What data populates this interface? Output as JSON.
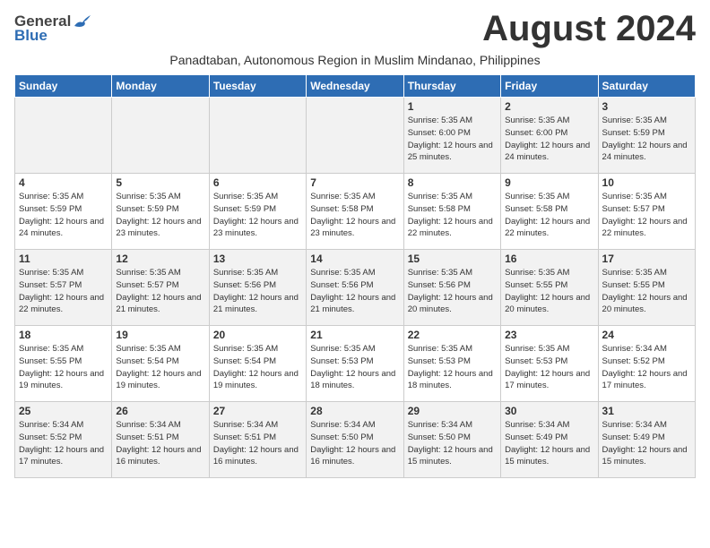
{
  "header": {
    "logo_general": "General",
    "logo_blue": "Blue",
    "month_title": "August 2024",
    "subtitle": "Panadtaban, Autonomous Region in Muslim Mindanao, Philippines"
  },
  "days_of_week": [
    "Sunday",
    "Monday",
    "Tuesday",
    "Wednesday",
    "Thursday",
    "Friday",
    "Saturday"
  ],
  "weeks": [
    {
      "days": [
        {
          "number": "",
          "info": ""
        },
        {
          "number": "",
          "info": ""
        },
        {
          "number": "",
          "info": ""
        },
        {
          "number": "",
          "info": ""
        },
        {
          "number": "1",
          "info": "Sunrise: 5:35 AM\nSunset: 6:00 PM\nDaylight: 12 hours\nand 25 minutes."
        },
        {
          "number": "2",
          "info": "Sunrise: 5:35 AM\nSunset: 6:00 PM\nDaylight: 12 hours\nand 24 minutes."
        },
        {
          "number": "3",
          "info": "Sunrise: 5:35 AM\nSunset: 5:59 PM\nDaylight: 12 hours\nand 24 minutes."
        }
      ]
    },
    {
      "days": [
        {
          "number": "4",
          "info": "Sunrise: 5:35 AM\nSunset: 5:59 PM\nDaylight: 12 hours\nand 24 minutes."
        },
        {
          "number": "5",
          "info": "Sunrise: 5:35 AM\nSunset: 5:59 PM\nDaylight: 12 hours\nand 23 minutes."
        },
        {
          "number": "6",
          "info": "Sunrise: 5:35 AM\nSunset: 5:59 PM\nDaylight: 12 hours\nand 23 minutes."
        },
        {
          "number": "7",
          "info": "Sunrise: 5:35 AM\nSunset: 5:58 PM\nDaylight: 12 hours\nand 23 minutes."
        },
        {
          "number": "8",
          "info": "Sunrise: 5:35 AM\nSunset: 5:58 PM\nDaylight: 12 hours\nand 22 minutes."
        },
        {
          "number": "9",
          "info": "Sunrise: 5:35 AM\nSunset: 5:58 PM\nDaylight: 12 hours\nand 22 minutes."
        },
        {
          "number": "10",
          "info": "Sunrise: 5:35 AM\nSunset: 5:57 PM\nDaylight: 12 hours\nand 22 minutes."
        }
      ]
    },
    {
      "days": [
        {
          "number": "11",
          "info": "Sunrise: 5:35 AM\nSunset: 5:57 PM\nDaylight: 12 hours\nand 22 minutes."
        },
        {
          "number": "12",
          "info": "Sunrise: 5:35 AM\nSunset: 5:57 PM\nDaylight: 12 hours\nand 21 minutes."
        },
        {
          "number": "13",
          "info": "Sunrise: 5:35 AM\nSunset: 5:56 PM\nDaylight: 12 hours\nand 21 minutes."
        },
        {
          "number": "14",
          "info": "Sunrise: 5:35 AM\nSunset: 5:56 PM\nDaylight: 12 hours\nand 21 minutes."
        },
        {
          "number": "15",
          "info": "Sunrise: 5:35 AM\nSunset: 5:56 PM\nDaylight: 12 hours\nand 20 minutes."
        },
        {
          "number": "16",
          "info": "Sunrise: 5:35 AM\nSunset: 5:55 PM\nDaylight: 12 hours\nand 20 minutes."
        },
        {
          "number": "17",
          "info": "Sunrise: 5:35 AM\nSunset: 5:55 PM\nDaylight: 12 hours\nand 20 minutes."
        }
      ]
    },
    {
      "days": [
        {
          "number": "18",
          "info": "Sunrise: 5:35 AM\nSunset: 5:55 PM\nDaylight: 12 hours\nand 19 minutes."
        },
        {
          "number": "19",
          "info": "Sunrise: 5:35 AM\nSunset: 5:54 PM\nDaylight: 12 hours\nand 19 minutes."
        },
        {
          "number": "20",
          "info": "Sunrise: 5:35 AM\nSunset: 5:54 PM\nDaylight: 12 hours\nand 19 minutes."
        },
        {
          "number": "21",
          "info": "Sunrise: 5:35 AM\nSunset: 5:53 PM\nDaylight: 12 hours\nand 18 minutes."
        },
        {
          "number": "22",
          "info": "Sunrise: 5:35 AM\nSunset: 5:53 PM\nDaylight: 12 hours\nand 18 minutes."
        },
        {
          "number": "23",
          "info": "Sunrise: 5:35 AM\nSunset: 5:53 PM\nDaylight: 12 hours\nand 17 minutes."
        },
        {
          "number": "24",
          "info": "Sunrise: 5:34 AM\nSunset: 5:52 PM\nDaylight: 12 hours\nand 17 minutes."
        }
      ]
    },
    {
      "days": [
        {
          "number": "25",
          "info": "Sunrise: 5:34 AM\nSunset: 5:52 PM\nDaylight: 12 hours\nand 17 minutes."
        },
        {
          "number": "26",
          "info": "Sunrise: 5:34 AM\nSunset: 5:51 PM\nDaylight: 12 hours\nand 16 minutes."
        },
        {
          "number": "27",
          "info": "Sunrise: 5:34 AM\nSunset: 5:51 PM\nDaylight: 12 hours\nand 16 minutes."
        },
        {
          "number": "28",
          "info": "Sunrise: 5:34 AM\nSunset: 5:50 PM\nDaylight: 12 hours\nand 16 minutes."
        },
        {
          "number": "29",
          "info": "Sunrise: 5:34 AM\nSunset: 5:50 PM\nDaylight: 12 hours\nand 15 minutes."
        },
        {
          "number": "30",
          "info": "Sunrise: 5:34 AM\nSunset: 5:49 PM\nDaylight: 12 hours\nand 15 minutes."
        },
        {
          "number": "31",
          "info": "Sunrise: 5:34 AM\nSunset: 5:49 PM\nDaylight: 12 hours\nand 15 minutes."
        }
      ]
    }
  ]
}
